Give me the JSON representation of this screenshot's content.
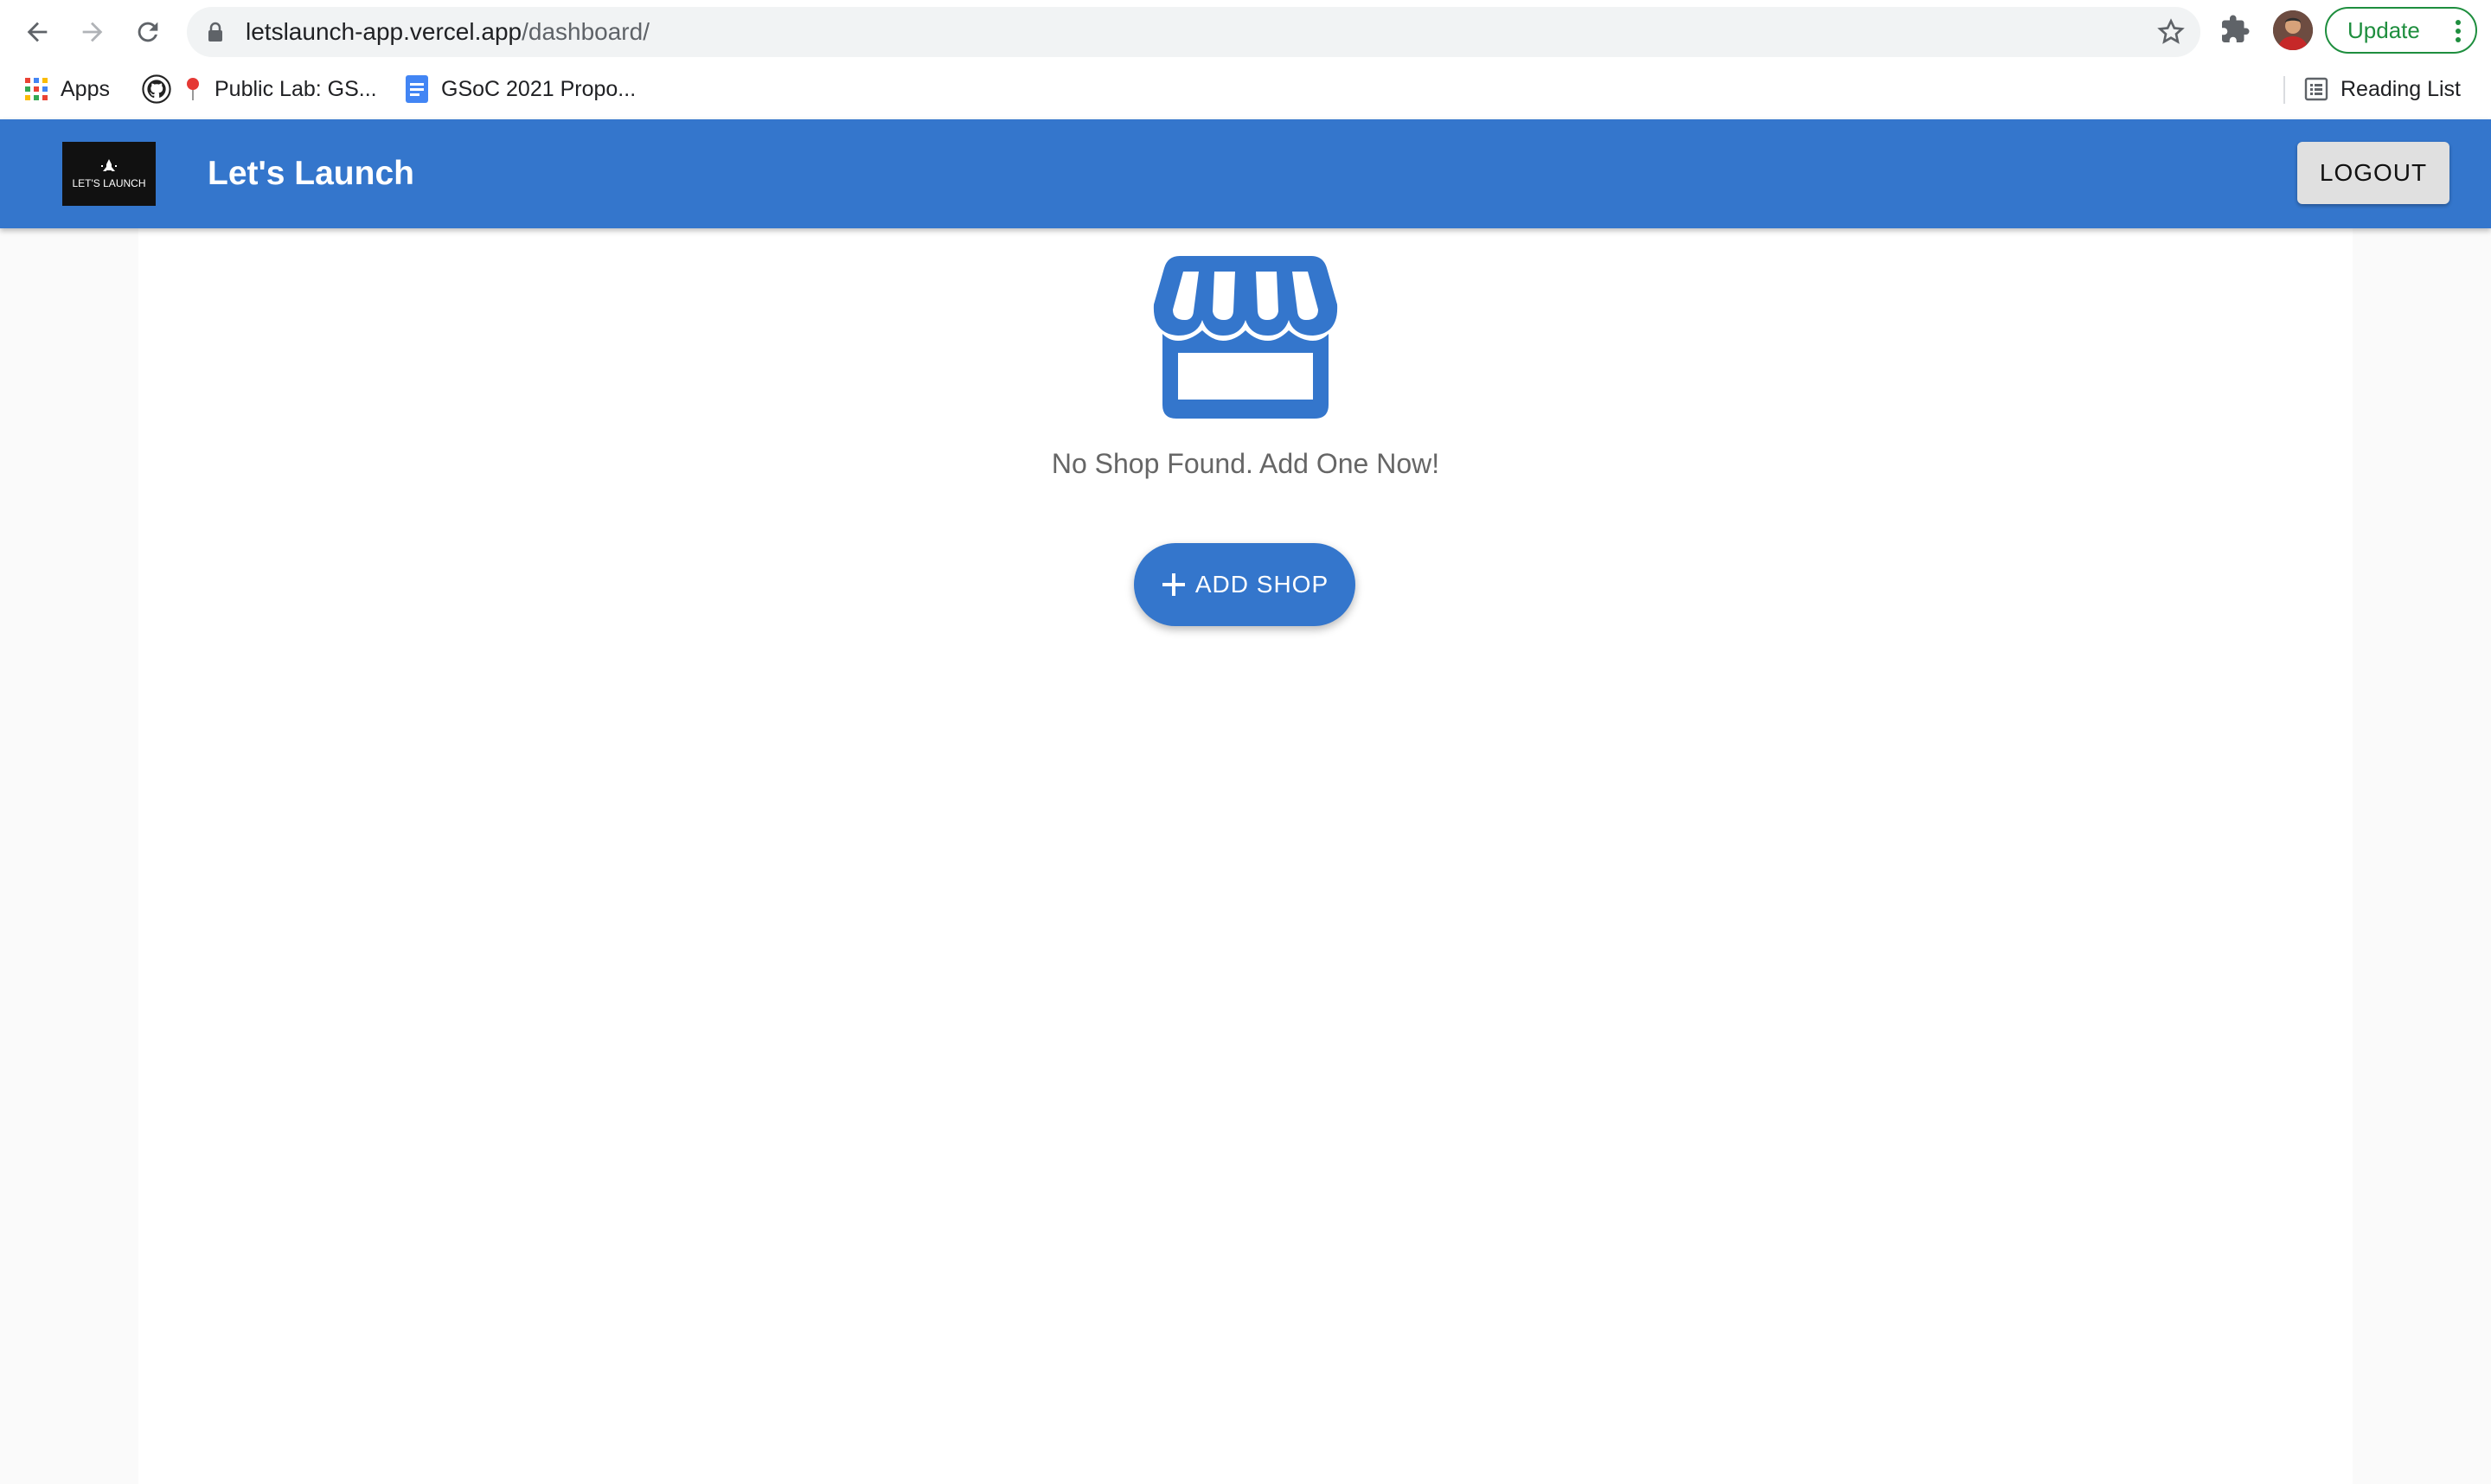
{
  "browser": {
    "url_host": "letslaunch-app.vercel.app",
    "url_path": "/dashboard/",
    "update_label": "Update",
    "bookmarks": [
      {
        "label": "Apps",
        "icon": "apps-grid-icon"
      },
      {
        "label": "",
        "icon": "github-icon"
      },
      {
        "label": "Public Lab: GS...",
        "icon": "pin-icon"
      },
      {
        "label": "GSoC 2021 Propo...",
        "icon": "google-docs-icon"
      }
    ],
    "reading_list_label": "Reading List"
  },
  "app": {
    "title": "Let's Launch",
    "logo_text": "LET'S LAUNCH",
    "logout_label": "LOGOUT",
    "empty_message": "No Shop Found. Add One Now!",
    "add_shop_label": "ADD SHOP",
    "empty_icon": "storefront-icon"
  },
  "colors": {
    "primary": "#3476cc",
    "update_green": "#1e8e3e",
    "background": "#fafafa"
  }
}
